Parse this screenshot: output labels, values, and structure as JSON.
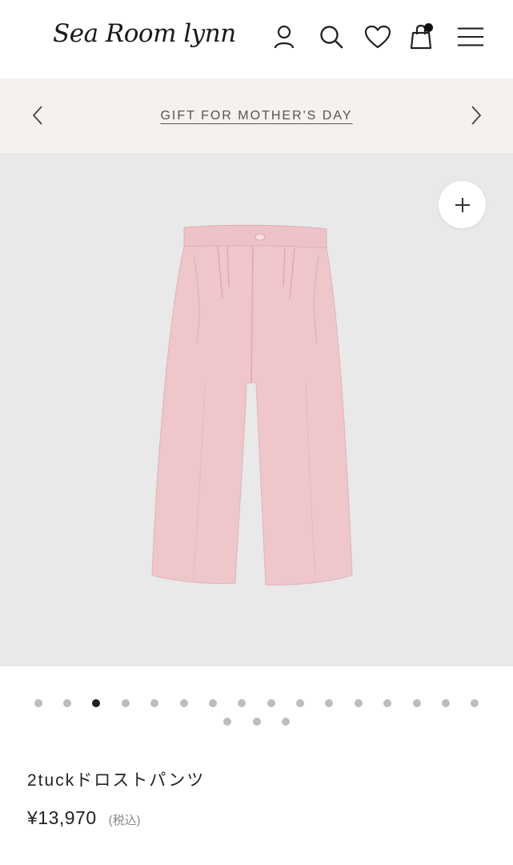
{
  "header": {
    "logo": "Sea Room lynn",
    "icons": [
      "account-icon",
      "search-icon",
      "heart-icon",
      "cart-icon",
      "menu-icon"
    ]
  },
  "banner": {
    "text": "GIFT FOR MOTHER'S DAY"
  },
  "gallery": {
    "slide_count": 19,
    "active_index": 2
  },
  "product": {
    "name": "2tuckドロストパンツ",
    "price": "¥13,970",
    "tax_note": "(税込)"
  },
  "colors": {
    "banner_bg": "#f5f1ee",
    "image_bg": "#e9e9ea",
    "product_pink": "#efc7cb"
  }
}
